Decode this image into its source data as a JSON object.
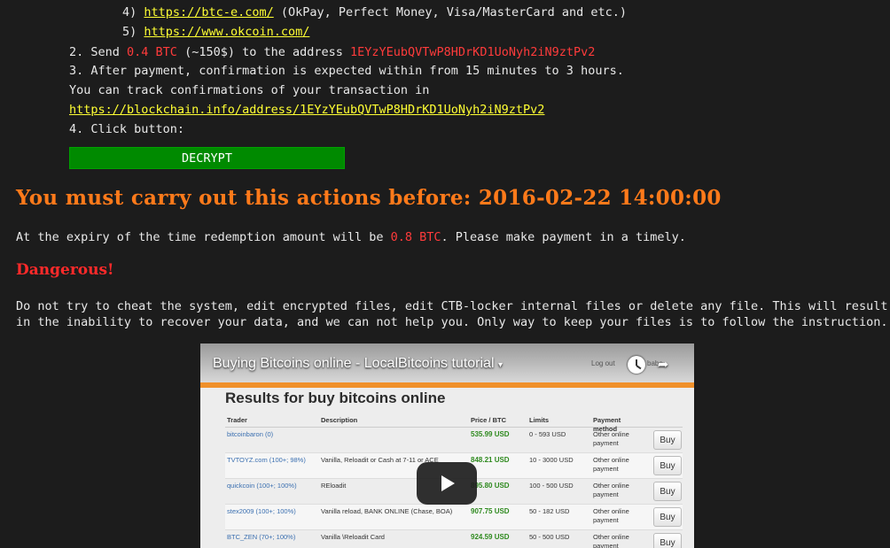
{
  "steps": {
    "item4_num": "4)",
    "item4_link": "https://btc-e.com/",
    "item4_note": "(OkPay, Perfect Money, Visa/MasterCard and etc.)",
    "item5_num": "5)",
    "item5_link": "https://www.okcoin.com/",
    "send_prefix": "2. Send ",
    "send_amount": "0.4 BTC",
    "send_mid": " (~150$) to the address ",
    "send_address": "1EYzYEubQVTwP8HDrKD1UoNyh2iN9ztPv2",
    "step3": "3. After payment, confirmation is expected within from 15 minutes to 3 hours.",
    "track_text": "You can track confirmations of your transaction in",
    "track_link": "https://blockchain.info/address/1EYzYEubQVTwP8HDrKD1UoNyh2iN9ztPv2",
    "step4": "4. Click button:",
    "decrypt_label": "DECRYPT"
  },
  "deadline": "You must carry out this actions before: 2016-02-22 14:00:00",
  "expiry": {
    "prefix": "At the expiry of the time redemption amount will be ",
    "amount": "0.8 BTC",
    "suffix": ". Please make payment in a timely."
  },
  "dangerous": "Dangerous!",
  "warning_line1": "Do not try to cheat the system, edit encrypted files, edit CTB-locker internal files or delete any file. This will result",
  "warning_line2": "in the inability to recover your data, and we can not help you. Only way to keep your files is to follow the instruction.",
  "video": {
    "title": "Buying Bitcoins online - LocalBitcoins tutorial",
    "login": "Log out",
    "user": "babe",
    "heading": "Results for buy bitcoins online",
    "columns": [
      "Trader",
      "Description",
      "Price / BTC",
      "Limits",
      "Payment method"
    ],
    "rows": [
      {
        "trader": "bitcoinbaron (0)",
        "desc": "",
        "price": "535.99 USD",
        "limits": "0 - 593 USD",
        "method": "Other online payment",
        "buy": "Buy"
      },
      {
        "trader": "TVTOYZ.com (100+; 98%)",
        "desc": "Vanilla, Reloadit or Cash at 7-11 or ACE",
        "price": "848.21 USD",
        "limits": "10 - 3000 USD",
        "method": "Other online payment",
        "buy": "Buy"
      },
      {
        "trader": "quickcoin (100+; 100%)",
        "desc": "REloadit",
        "price": "895.80 USD",
        "limits": "100 - 500 USD",
        "method": "Other online payment",
        "buy": "Buy"
      },
      {
        "trader": "stex2009 (100+; 100%)",
        "desc": "Vanilla reload, BANK ONLINE (Chase, BOA)",
        "price": "907.75 USD",
        "limits": "50 - 182 USD",
        "method": "Other online payment",
        "buy": "Buy"
      },
      {
        "trader": "BTC_ZEN (70+; 100%)",
        "desc": "Vanilla \\Reloadit Card",
        "price": "924.59 USD",
        "limits": "50 - 500 USD",
        "method": "Other online payment",
        "buy": "Buy"
      }
    ]
  },
  "colors": {
    "background": "#1c1c1c",
    "link": "#ffff33",
    "amount_red": "#ff3b3b",
    "deadline_orange": "#ff7a1a",
    "button_green": "#008a00"
  }
}
